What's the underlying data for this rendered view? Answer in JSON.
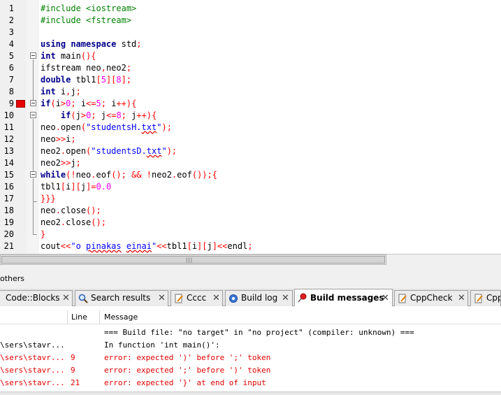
{
  "editor": {
    "line_numbers": [
      "1",
      "2",
      "3",
      "4",
      "5",
      "6",
      "7",
      "8",
      "9",
      "10",
      "11",
      "12",
      "13",
      "14",
      "15",
      "16",
      "17",
      "18",
      "19",
      "20",
      "21"
    ],
    "breakpoint_line": "9",
    "colors": {
      "preprocessor": "#008000",
      "keyword": "#00008b",
      "number": "#f000f0",
      "operator": "#ff0000",
      "string": "#0000ff",
      "breakpoint": "#e60000"
    }
  },
  "panel": {
    "title": "others"
  },
  "tabs": [
    {
      "label": "Code::Blocks",
      "icon": "codeblocks-icon"
    },
    {
      "label": "Search results",
      "icon": "search-icon"
    },
    {
      "label": "Cccc",
      "icon": "document-pencil-icon"
    },
    {
      "label": "Build log",
      "icon": "gear-icon"
    },
    {
      "label": "Build messages",
      "icon": "pin-icon",
      "active": true
    },
    {
      "label": "CppCheck",
      "icon": "document-pencil-icon"
    },
    {
      "label": "Cpp",
      "icon": "document-pencil-icon"
    }
  ],
  "log": {
    "columns": {
      "file": "",
      "line": "Line",
      "message": "Message"
    },
    "rows": [
      {
        "file": "",
        "line": "",
        "message": "=== Build file: \"no target\" in \"no project\" (compiler: unknown) ===",
        "type": "info"
      },
      {
        "file": "\\sers\\stavr...",
        "line": "",
        "message": "In function 'int main()':",
        "type": "info"
      },
      {
        "file": "\\sers\\stavr...",
        "line": "9",
        "message": "error: expected ')' before ';' token",
        "type": "error"
      },
      {
        "file": "\\sers\\stavr...",
        "line": "9",
        "message": "error: expected ';' before ')' token",
        "type": "error"
      },
      {
        "file": "\\sers\\stavr...",
        "line": "21",
        "message": "error: expected '}' at end of input",
        "type": "error"
      }
    ]
  }
}
